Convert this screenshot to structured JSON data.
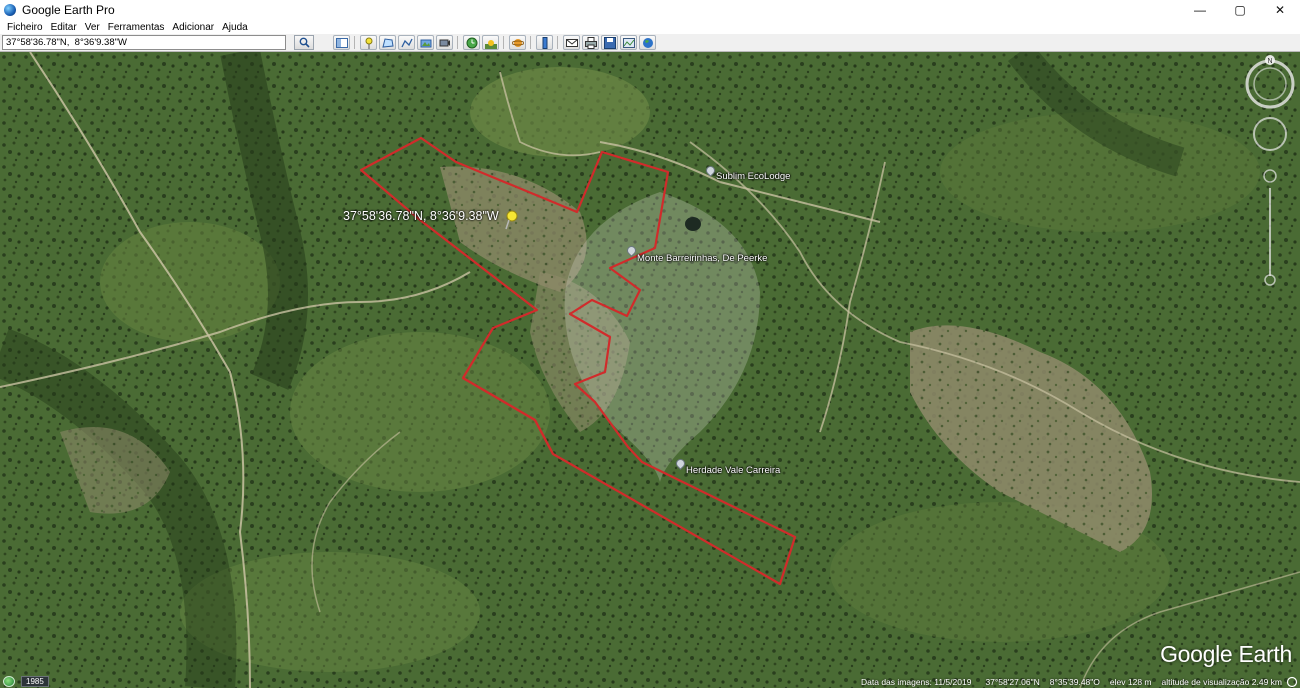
{
  "window": {
    "title": "Google Earth Pro",
    "controls": {
      "minimize": "—",
      "maximize": "▢",
      "close": "✕"
    }
  },
  "menu": {
    "items": [
      "Ficheiro",
      "Editar",
      "Ver",
      "Ferramentas",
      "Adicionar",
      "Ajuda"
    ]
  },
  "search": {
    "value": "37°58'36.78\"N,  8°36'9.38\"W",
    "button_icon": "search-icon"
  },
  "toolbar": {
    "buttons": [
      "sidebar-toggle-icon",
      "placemark-icon",
      "polygon-icon",
      "path-icon",
      "image-overlay-icon",
      "record-tour-icon",
      "historical-imagery-icon",
      "sun-icon",
      "planets-icon",
      "ruler-icon",
      "email-icon",
      "print-icon",
      "save-image-icon",
      "view-in-maps-icon",
      "earth-icon"
    ]
  },
  "map": {
    "marker_label": "37°58'36.78\"N,  8°36'9.38\"W",
    "places": [
      {
        "name": "Sublim EcoLodge"
      },
      {
        "name": "Monte Barreirinhas, De Peerke"
      },
      {
        "name": "Herdade Vale Carreira"
      }
    ],
    "compass_label": "N",
    "brand": "Google Earth",
    "boundary_color": "#d12b2b"
  },
  "status": {
    "year": "1985",
    "imagery_date": "Data das imagens: 11/5/2019",
    "lat": "37°58'27.06\"N",
    "lon": "8°35'39.48\"O",
    "elev": "elev  128 m",
    "eye_alt": "altitude de visualização  2.49 km"
  }
}
